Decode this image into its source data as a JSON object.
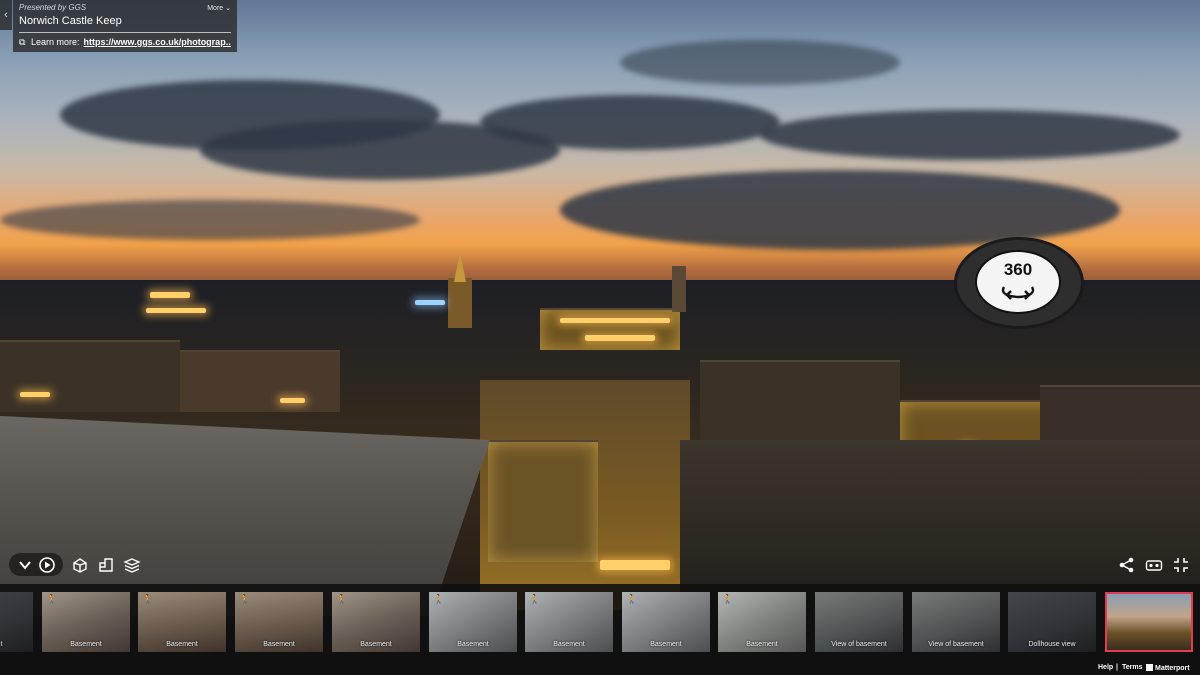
{
  "tour": {
    "presented_by": "Presented by GGS",
    "more_label": "More",
    "title": "Norwich Castle Keep",
    "learn_more_label": "Learn more:",
    "learn_more_url": "https://www.ggs.co.uk/photograp..."
  },
  "badge": {
    "text": "360"
  },
  "controls": {
    "left": [
      "chevron-down-icon",
      "play-icon",
      "dollhouse-icon",
      "floorplan-icon",
      "floors-icon"
    ],
    "right": [
      "share-icon",
      "vr-icon",
      "fullscreen-icon"
    ]
  },
  "thumbnails": [
    {
      "label": "asement",
      "walk": false,
      "tint": "tint-f"
    },
    {
      "label": "Basement",
      "walk": true,
      "tint": "tint-a"
    },
    {
      "label": "Basement",
      "walk": true,
      "tint": "tint-b"
    },
    {
      "label": "Basement",
      "walk": true,
      "tint": "tint-b"
    },
    {
      "label": "Basement",
      "walk": true,
      "tint": "tint-a"
    },
    {
      "label": "Basement",
      "walk": true,
      "tint": "tint-c"
    },
    {
      "label": "Basement",
      "walk": true,
      "tint": "tint-c"
    },
    {
      "label": "Basement",
      "walk": true,
      "tint": "tint-c"
    },
    {
      "label": "Basement",
      "walk": true,
      "tint": "tint-d"
    },
    {
      "label": "View of basement",
      "walk": false,
      "tint": "tint-e"
    },
    {
      "label": "View of basement",
      "walk": false,
      "tint": "tint-e"
    },
    {
      "label": "Dollhouse view",
      "walk": false,
      "tint": "tint-f"
    },
    {
      "label": "",
      "walk": false,
      "tint": "active"
    }
  ],
  "footer": {
    "help": "Help",
    "sep": "|",
    "terms": "Terms",
    "brand": "Matterport"
  }
}
